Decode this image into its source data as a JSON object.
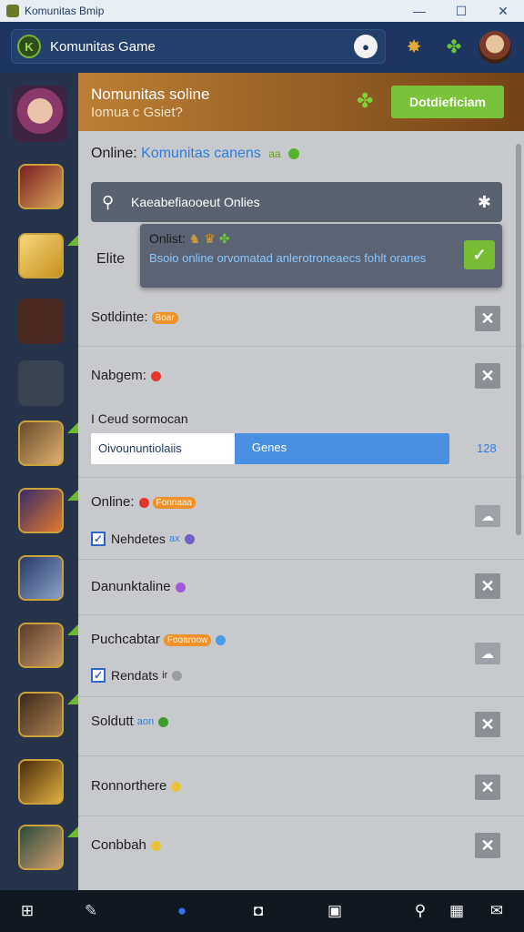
{
  "window": {
    "title": "Komunitas Bmip",
    "minimize_icon": "minimize-icon",
    "maximize_icon": "maximize-icon",
    "close_icon": "close-icon"
  },
  "header": {
    "brand": "Komunitas Game",
    "brand_prefix": "K",
    "icons": [
      "user-icon",
      "star-badge-icon",
      "leaf-icon",
      "profile-avatar"
    ]
  },
  "banner": {
    "title": "Nomunitas soline",
    "subtitle": "Iomua c Gsiet?",
    "button": "Dotdieficiam"
  },
  "online_header": {
    "label": "Online:",
    "link": "Komunitas canens",
    "tag": "aa"
  },
  "search": {
    "placeholder": "Kaeabefiaooeut Onlies"
  },
  "popup": {
    "title": "Onlist:",
    "body": "Bsoio online orvomatad anlerotroneaecs fohlt oranes"
  },
  "elite_label": "Elite",
  "rows": [
    {
      "label": "Sotldinte:",
      "badge": "Boar"
    },
    {
      "label": "Nabgem:"
    },
    {
      "label": "Online:",
      "badge": "Fonnaaa"
    },
    {
      "label": "Danunktaline"
    },
    {
      "label": "Puchcabtar",
      "badge": "Fooaroow"
    },
    {
      "label": "Soldutt",
      "badge": "aon"
    },
    {
      "label": "Ronnorthere"
    },
    {
      "label": "Conbbah"
    }
  ],
  "download": {
    "label": "I  Ceud sormocan",
    "left_text": "Oivoununtiolaiis",
    "button_text": "Genes",
    "value": "128",
    "progress": 0.6
  },
  "sub_checks": [
    {
      "label": "Nehdetes",
      "extra": "ax"
    },
    {
      "label": "Rendats",
      "extra": "ir"
    }
  ],
  "colors": {
    "accent_green": "#79c33a",
    "header_blue": "#1d3560",
    "link_blue": "#2d7fe0",
    "badge_orange": "#f0922a"
  },
  "taskbar": {
    "icons": [
      "windows-start-icon",
      "pen-icon",
      "rocket-icon",
      "record-icon",
      "screen-icon",
      "key-icon",
      "calculator-icon",
      "chat-icon"
    ]
  }
}
